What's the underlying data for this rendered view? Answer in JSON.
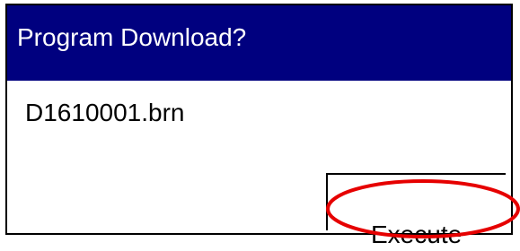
{
  "dialog": {
    "title": "Program Download?",
    "filename": "D1610001.brn",
    "execute_label": "Execute"
  },
  "colors": {
    "titlebar": "#00007f",
    "title_text": "#ffffff",
    "highlight_ellipse": "#e60000"
  }
}
